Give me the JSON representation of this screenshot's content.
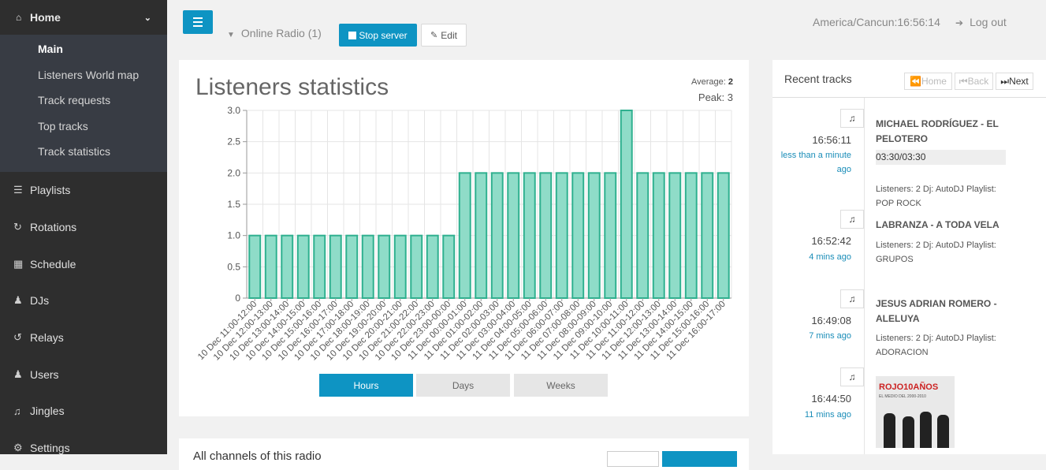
{
  "sidebar": {
    "home_label": "Home",
    "submenu": [
      "Main",
      "Listeners World map",
      "Track requests",
      "Top tracks",
      "Track statistics"
    ],
    "items": [
      {
        "label": "Playlists",
        "icon": "list-icon"
      },
      {
        "label": "Rotations",
        "icon": "refresh-icon"
      },
      {
        "label": "Schedule",
        "icon": "calendar-icon"
      },
      {
        "label": "DJs",
        "icon": "user-icon"
      },
      {
        "label": "Relays",
        "icon": "repeat-icon"
      },
      {
        "label": "Users",
        "icon": "users-icon"
      },
      {
        "label": "Jingles",
        "icon": "bell-icon"
      },
      {
        "label": "Settings",
        "icon": "gears-icon"
      }
    ]
  },
  "topbar": {
    "radio_select": "Online Radio (1)",
    "stop_label": "Stop server",
    "edit_label": "Edit",
    "clock": "America/Cancun:16:56:14",
    "logout_label": "Log out"
  },
  "stats": {
    "title": "Listeners statistics",
    "average_label": "Average:",
    "average_value": "2",
    "peak": "Peak: 3",
    "tabs": [
      "Hours",
      "Days",
      "Weeks"
    ],
    "active_tab": "Hours"
  },
  "chart_data": {
    "type": "bar",
    "categories": [
      "10 Dec 11:00-12:00",
      "10 Dec 12:00-13:00",
      "10 Dec 13:00-14:00",
      "10 Dec 14:00-15:00",
      "10 Dec 15:00-16:00",
      "10 Dec 16:00-17:00",
      "10 Dec 17:00-18:00",
      "10 Dec 18:00-19:00",
      "10 Dec 19:00-20:00",
      "10 Dec 20:00-21:00",
      "10 Dec 21:00-22:00",
      "10 Dec 22:00-23:00",
      "10 Dec 23:00-00:00",
      "11 Dec 00:00-01:00",
      "11 Dec 01:00-02:00",
      "11 Dec 02:00-03:00",
      "11 Dec 03:00-04:00",
      "11 Dec 04:00-05:00",
      "11 Dec 05:00-06:00",
      "11 Dec 06:00-07:00",
      "11 Dec 07:00-08:00",
      "11 Dec 08:00-09:00",
      "11 Dec 09:00-10:00",
      "11 Dec 10:00-11:00",
      "11 Dec 11:00-12:00",
      "11 Dec 12:00-13:00",
      "11 Dec 13:00-14:00",
      "11 Dec 14:00-15:00",
      "11 Dec 15:00-16:00",
      "11 Dec 16:00-17:00"
    ],
    "values": [
      1,
      1,
      1,
      1,
      1,
      1,
      1,
      1,
      1,
      1,
      1,
      1,
      1,
      2,
      2,
      2,
      2,
      2,
      2,
      2,
      2,
      2,
      2,
      3,
      2,
      2,
      2,
      2,
      2,
      2
    ],
    "ylim": [
      0,
      3
    ],
    "yticks": [
      "0",
      "0.5",
      "1.0",
      "1.5",
      "2.0",
      "2.5",
      "3.0"
    ],
    "grid": true,
    "bar_fill": "#8fdcc8",
    "bar_stroke": "#2fb08f"
  },
  "recent": {
    "title": "Recent tracks",
    "nav": [
      "Home",
      "Back",
      "Next"
    ],
    "tracks": [
      {
        "time": "16:56:11",
        "ago": "less than a minute ago",
        "title": "MICHAEL RODRÍGUEZ - EL PELOTERO",
        "progress": "03:30/03:30",
        "meta": "Listeners: 2 Dj: AutoDJ Playlist: POP ROCK"
      },
      {
        "time": "16:52:42",
        "ago": "4 mins ago",
        "title": "LABRANZA - A TODA VELA",
        "meta": "Listeners: 2 Dj: AutoDJ Playlist: GRUPOS"
      },
      {
        "time": "16:49:08",
        "ago": "7 mins ago",
        "title": "JESUS ADRIAN ROMERO - ALELUYA",
        "meta": "Listeners: 2 Dj: AutoDJ Playlist: ADORACION"
      },
      {
        "time": "16:44:50",
        "ago": "11 mins ago",
        "cover_title": "ROJO10AÑOS",
        "cover_sub": "EL MEDIO DEL 2000-2010"
      }
    ]
  },
  "panel2": {
    "title": "All channels of this radio"
  }
}
